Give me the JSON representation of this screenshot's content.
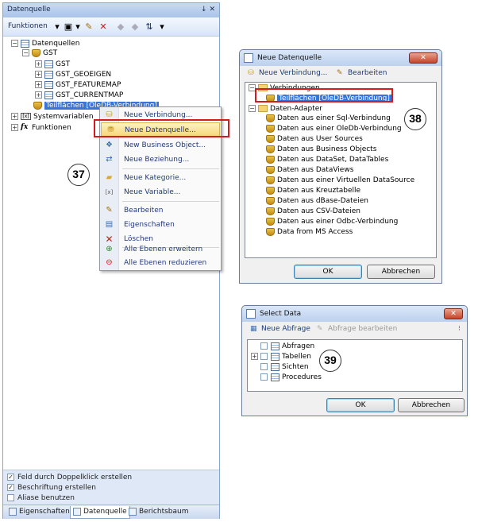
{
  "left_panel": {
    "title": "Datenquelle",
    "title_controls": "↓ ✕",
    "toolbar_label": "Funktionen",
    "tree": {
      "root": "Datenquellen",
      "gst": "GST",
      "tables": [
        "GST",
        "GST_GEOEIGEN",
        "GST_FEATUREMAP",
        "GST_CURRENTMAP"
      ],
      "teilflaechen": "Teilflächen [OleDB-Verbindung]",
      "systemvariablen": "Systemvariablen",
      "funktionen": "Funktionen"
    },
    "options": [
      {
        "label": "Feld durch Doppelklick erstellen",
        "checked": true
      },
      {
        "label": "Beschriftung erstellen",
        "checked": true
      },
      {
        "label": "Aliase benutzen",
        "checked": false
      }
    ],
    "tabs": [
      "Eigenschaften",
      "Datenquelle",
      "Berichtsbaum"
    ]
  },
  "context_menu": {
    "items": [
      {
        "label": "Neue Verbindung...",
        "icon": "connection-icon"
      },
      {
        "label": "Neue Datenquelle...",
        "icon": "datasource-icon",
        "highlighted": true
      },
      {
        "label": "New Business Object...",
        "icon": "business-object-icon"
      },
      {
        "label": "Neue Beziehung...",
        "icon": "relation-icon"
      },
      {
        "label": "Neue Kategorie...",
        "icon": "folder-icon"
      },
      {
        "label": "Neue Variable...",
        "icon": "variable-icon"
      },
      {
        "label": "Bearbeiten",
        "icon": "edit-icon"
      },
      {
        "label": "Eigenschaften",
        "icon": "properties-icon"
      },
      {
        "label": "Löschen",
        "icon": "delete-icon"
      },
      {
        "label": "Alle Ebenen erweitern",
        "icon": "expand-icon"
      },
      {
        "label": "Alle Ebenen reduzieren",
        "icon": "collapse-icon"
      }
    ]
  },
  "dialog_datasource": {
    "title": "Neue Datenquelle",
    "close": "✕",
    "toolbar": {
      "new_connection": "Neue Verbindung...",
      "edit": "Bearbeiten"
    },
    "tree": {
      "verbindungen": "Verbindungen",
      "teilflaechen": "Teilflächen [OleDB-Verbindung]",
      "adapter": "Daten-Adapter",
      "adapters": [
        "Daten aus einer Sql-Verbindung",
        "Daten aus einer OleDb-Verbindung",
        "Daten aus User Sources",
        "Daten aus Business Objects",
        "Daten aus DataSet, DataTables",
        "Daten aus DataViews",
        "Daten aus einer Virtuellen DataSource",
        "Daten aus Kreuztabelle",
        "Daten aus dBase-Dateien",
        "Daten aus CSV-Dateien",
        "Daten aus einer Odbc-Verbindung",
        "Data from MS Access"
      ]
    },
    "ok": "OK",
    "cancel": "Abbrechen"
  },
  "dialog_select": {
    "title": "Select Data",
    "close": "✕",
    "toolbar": {
      "new_query": "Neue Abfrage",
      "edit_query": "Abfrage bearbeiten"
    },
    "tree": [
      "Abfragen",
      "Tabellen",
      "Sichten",
      "Procedures"
    ],
    "ok": "OK",
    "cancel": "Abbrechen"
  },
  "callouts": {
    "c37": "37",
    "c38": "38",
    "c39": "39"
  },
  "colors": {
    "highlight_red": "#d51b1b",
    "selection_blue": "#3875d7",
    "menu_highlight": "#f6d877"
  }
}
